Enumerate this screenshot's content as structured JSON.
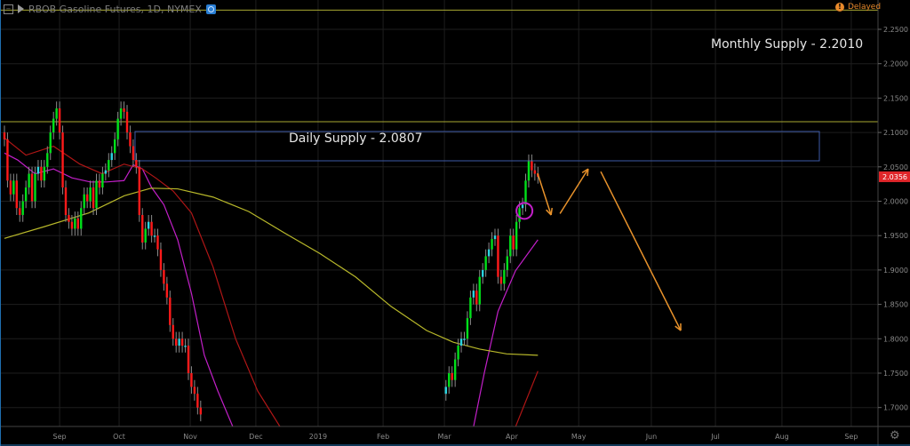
{
  "header": {
    "symbol_title": "RBOB Gasoline Futures, 1D, NYMEX",
    "status": "Delayed",
    "status_icon": "exclamation-icon"
  },
  "colors": {
    "background": "#000000",
    "up": "#00e01a",
    "up_small": "#2ad4e0",
    "down": "#ff1a1a",
    "wick": "#8a8a8a",
    "grid": "#1e1e1e",
    "ma_fast": "#c21fc8",
    "ma_mid": "#b01616",
    "ma_slow": "#b8b82a",
    "level": "#a8a832",
    "zone": "#3d5aa8",
    "arrow": "#e8922b",
    "last_price_bg": "#e0262a"
  },
  "chart_data": {
    "type": "candlestick",
    "title": "RBOB Gasoline Futures, 1D, NYMEX",
    "ylim": [
      1.68,
      2.28
    ],
    "x_unit": "trading-day index",
    "xlim": [
      0,
      284
    ],
    "y_ticks": [
      "2.2500",
      "2.2000",
      "2.1500",
      "2.1000",
      "2.0500",
      "2.0000",
      "1.9500",
      "1.9000",
      "1.8500",
      "1.8000",
      "1.7500",
      "1.7000"
    ],
    "x_ticks": [
      {
        "label": "Sep",
        "i": 18
      },
      {
        "label": "Oct",
        "i": 37.4
      },
      {
        "label": "Nov",
        "i": 60.6
      },
      {
        "label": "Dec",
        "i": 82
      },
      {
        "label": "2019",
        "i": 102.3
      },
      {
        "label": "Feb",
        "i": 123.5
      },
      {
        "label": "Mar",
        "i": 143.5
      },
      {
        "label": "Apr",
        "i": 165.5
      },
      {
        "label": "May",
        "i": 187.3
      },
      {
        "label": "Jun",
        "i": 211
      },
      {
        "label": "Jul",
        "i": 231.9
      },
      {
        "label": "Aug",
        "i": 253.6
      },
      {
        "label": "Sep",
        "i": 276.2
      }
    ],
    "last_price": "2.0356",
    "wick": 0.01,
    "segments": [
      {
        "start": 0,
        "open": 2.1,
        "closes": [
          2.09,
          2.03,
          2.01,
          2.03,
          1.99,
          1.98,
          2.0,
          2.02,
          2.04,
          2.0,
          2.04,
          2.05,
          2.03,
          2.05,
          2.07,
          2.1,
          2.12,
          2.135,
          2.1,
          2.02,
          1.98,
          1.97,
          1.96,
          1.975,
          1.96,
          1.99,
          2.01,
          2.0,
          2.02,
          1.99,
          2.03,
          2.02,
          2.04,
          2.045,
          2.06,
          2.07,
          2.09,
          2.12,
          2.135,
          2.13,
          2.1,
          2.08,
          2.06,
          2.05,
          1.98,
          1.94,
          1.96,
          1.97,
          1.95,
          1.95,
          1.93,
          1.9,
          1.88,
          1.86,
          1.82,
          1.8,
          1.79,
          1.8,
          1.79,
          1.79,
          1.75,
          1.73,
          1.72,
          1.7,
          1.69
        ]
      },
      {
        "start": 144,
        "open": 1.72,
        "closes": [
          1.73,
          1.75,
          1.74,
          1.77,
          1.79,
          1.8,
          1.8,
          1.83,
          1.86,
          1.87,
          1.85,
          1.89,
          1.9,
          1.92,
          1.93,
          1.945,
          1.95,
          1.89,
          1.88,
          1.9,
          1.92,
          1.95,
          1.93,
          1.97,
          1.99,
          1.995,
          2.03,
          2.058,
          2.045,
          2.04,
          2.0356
        ]
      }
    ],
    "moving_averages": [
      {
        "name": "ma_fast",
        "segments": [
          [
            [
              0,
              2.07
            ],
            [
              4.3,
              2.06
            ],
            [
              10,
              2.04
            ],
            [
              16,
              2.047
            ],
            [
              22,
              2.034
            ],
            [
              28,
              2.028
            ],
            [
              33.3,
              2.028
            ],
            [
              39,
              2.03
            ],
            [
              42,
              2.053
            ],
            [
              45,
              2.047
            ],
            [
              48,
              2.02
            ],
            [
              52,
              1.995
            ],
            [
              56.5,
              1.944
            ],
            [
              61,
              1.866
            ],
            [
              65.2,
              1.776
            ],
            [
              69.6,
              1.724
            ],
            [
              74.5,
              1.672
            ],
            [
              80,
              1.6
            ]
          ],
          [
            [
              150,
              1.6
            ],
            [
              153,
              1.672
            ],
            [
              156.5,
              1.75
            ],
            [
              161,
              1.84
            ],
            [
              166.7,
              1.899
            ],
            [
              174,
              1.944
            ]
          ]
        ]
      },
      {
        "name": "ma_mid",
        "segments": [
          [
            [
              0,
              2.092
            ],
            [
              7,
              2.067
            ],
            [
              16,
              2.08
            ],
            [
              24.6,
              2.054
            ],
            [
              31.9,
              2.04
            ],
            [
              39,
              2.054
            ],
            [
              45,
              2.047
            ],
            [
              49.3,
              2.034
            ],
            [
              55,
              2.015
            ],
            [
              61,
              1.983
            ],
            [
              68,
              1.905
            ],
            [
              75.4,
              1.8
            ],
            [
              82.6,
              1.724
            ],
            [
              89.9,
              1.672
            ],
            [
              96,
              1.6
            ]
          ],
          [
            [
              164,
              1.6
            ],
            [
              166.7,
              1.672
            ],
            [
              174,
              1.753
            ]
          ]
        ]
      },
      {
        "name": "ma_slow",
        "segments": [
          [
            [
              0,
              1.946
            ],
            [
              13,
              1.963
            ],
            [
              27.5,
              1.983
            ],
            [
              39.1,
              2.008
            ],
            [
              47.8,
              2.019
            ],
            [
              56.5,
              2.018
            ],
            [
              68.1,
              2.006
            ],
            [
              79.7,
              1.985
            ],
            [
              91.3,
              1.954
            ],
            [
              102.9,
              1.924
            ],
            [
              114.5,
              1.89
            ],
            [
              126.1,
              1.847
            ],
            [
              137.7,
              1.812
            ],
            [
              146.4,
              1.795
            ],
            [
              155,
              1.785
            ],
            [
              163.8,
              1.778
            ],
            [
              174,
              1.776
            ]
          ]
        ]
      }
    ],
    "levels": [
      2.278,
      2.1157
    ],
    "zone": {
      "i0": 42.6,
      "i1": 265.8,
      "top": 2.1014,
      "bottom": 2.0588
    },
    "arrows": [
      [
        [
          173.9,
          2.0407
        ],
        [
          178.3,
          1.98
        ]
      ],
      [
        [
          181.2,
          1.982
        ],
        [
          190.4,
          2.047
        ]
      ],
      [
        [
          194.5,
          2.043
        ],
        [
          220.6,
          1.812
        ]
      ]
    ],
    "circle": {
      "i": 169.6,
      "price": 1.986
    },
    "annotations": {
      "daily_supply": "Daily Supply - 2.0807",
      "monthly_supply": "Monthly Supply - 2.2010"
    }
  }
}
